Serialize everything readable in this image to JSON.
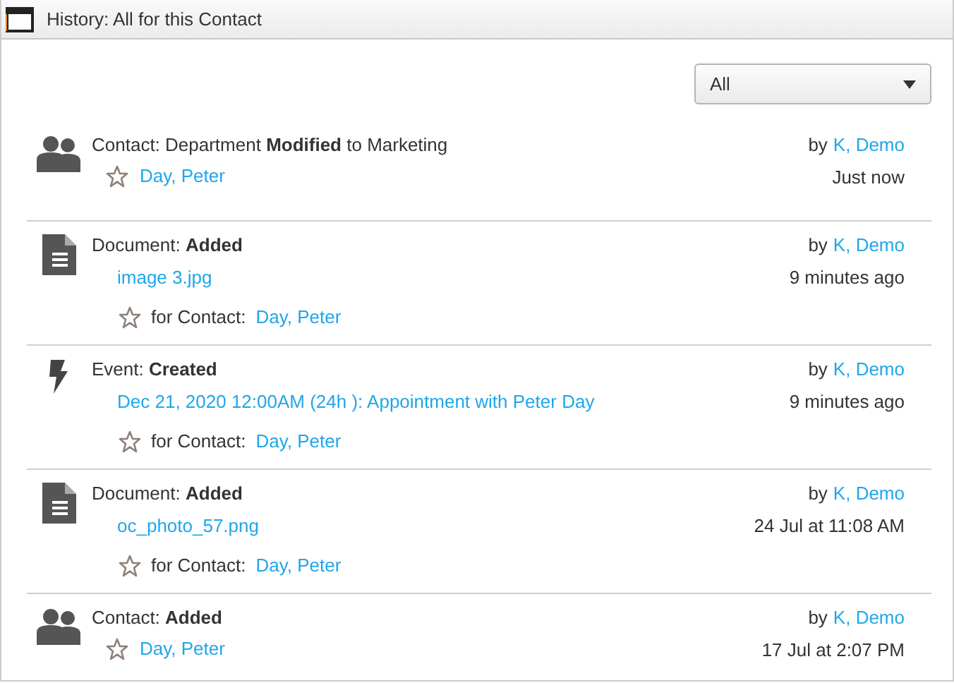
{
  "panel": {
    "title": "History: All for this Contact"
  },
  "filter": {
    "value": "All"
  },
  "entries": [
    {
      "kind": "contact",
      "summary": "Contact: Department **Modified** to Marketing",
      "contact": "Day, Peter",
      "by": "by",
      "author": "K, Demo",
      "time": "Just now"
    },
    {
      "kind": "document",
      "summary": "Document: **Added**",
      "item": "image 3.jpg",
      "contact_prefix": "for Contact:",
      "contact": "Day, Peter",
      "by": "by",
      "author": "K, Demo",
      "time": "9 minutes ago"
    },
    {
      "kind": "event",
      "summary": "Event: **Created**",
      "item": "Dec 21, 2020 12:00AM (24h ): Appointment with Peter Day",
      "contact_prefix": "for Contact:",
      "contact": "Day, Peter",
      "by": "by",
      "author": "K, Demo",
      "time": "9 minutes ago"
    },
    {
      "kind": "document",
      "summary": "Document: **Added**",
      "item": "oc_photo_57.png",
      "contact_prefix": "for Contact:",
      "contact": "Day, Peter",
      "by": "by",
      "author": "K, Demo",
      "time": "24 Jul at 11:08 AM"
    },
    {
      "kind": "contact",
      "summary": "Contact: **Added**",
      "contact": "Day, Peter",
      "by": "by",
      "author": "K, Demo",
      "time": "17 Jul at 2:07 PM"
    }
  ]
}
